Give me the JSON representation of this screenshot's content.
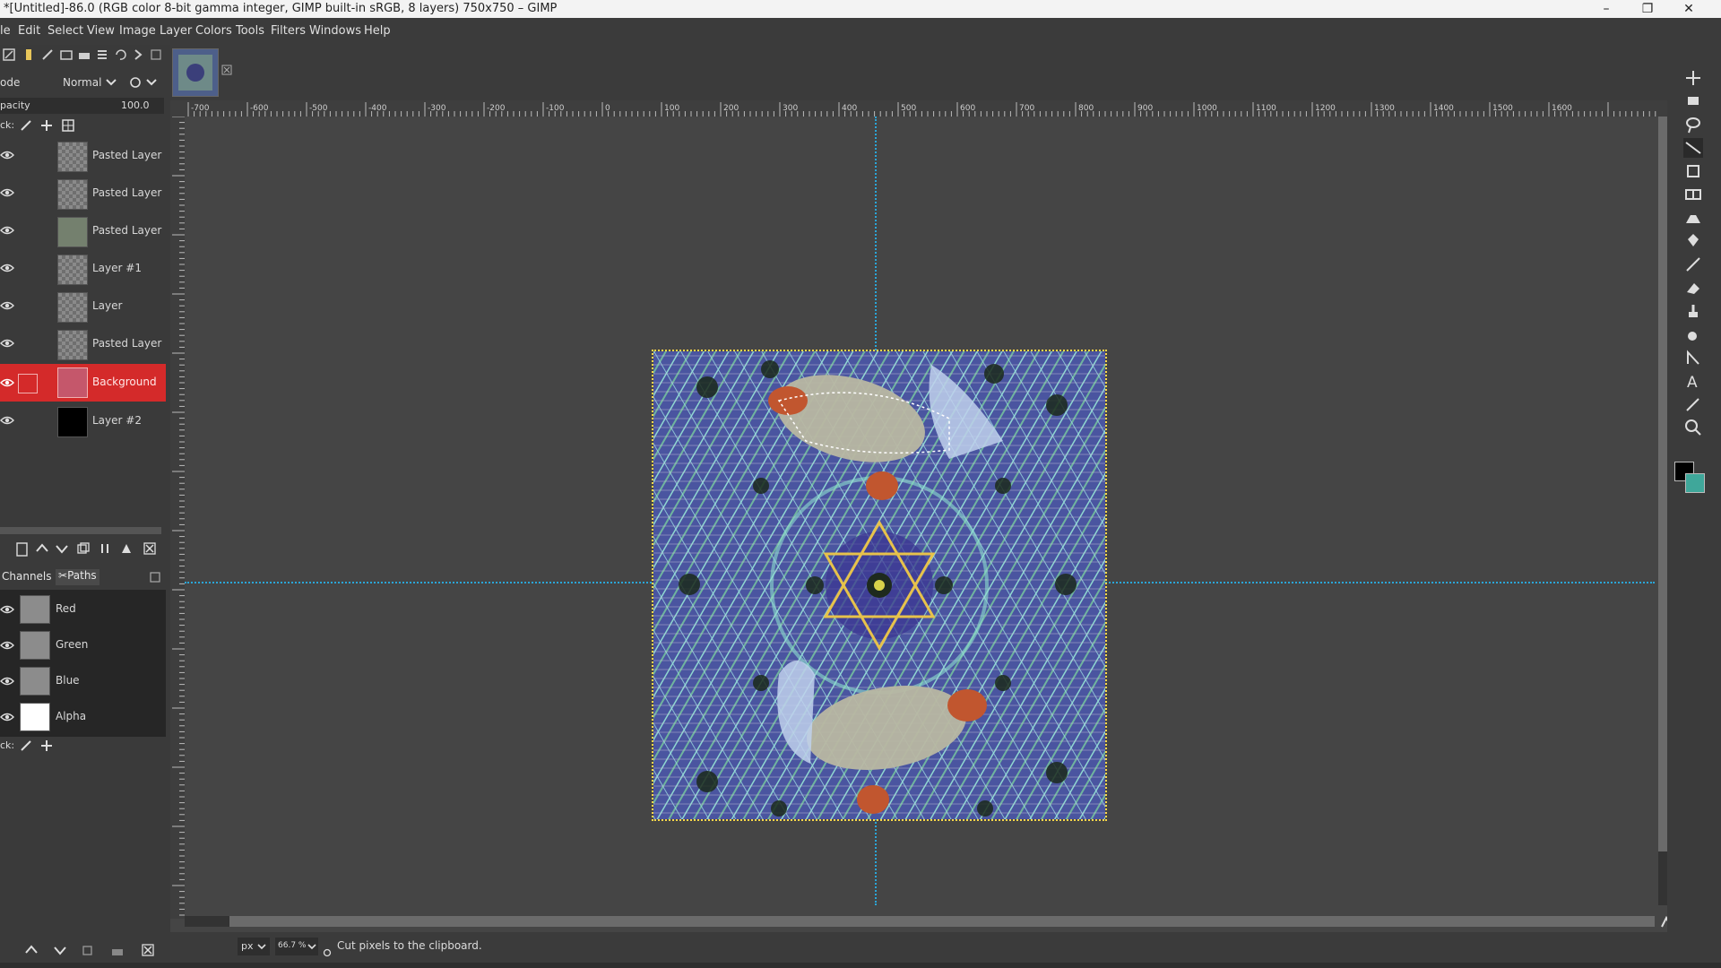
{
  "window": {
    "title": "*[Untitled]-86.0 (RGB color 8-bit gamma integer, GIMP built-in sRGB, 8 layers) 750x750 – GIMP",
    "controls": [
      "–",
      "❐",
      "✕"
    ]
  },
  "menu": [
    "le",
    "Edit",
    "Select",
    "View",
    "Image",
    "Layer",
    "Colors",
    "Tools",
    "Filters",
    "Windows",
    "Help"
  ],
  "layers_panel": {
    "mode_label": "ode",
    "mode_value": "Normal",
    "opacity_label": "pacity",
    "opacity_value": "100.0",
    "lock_label": "ck:",
    "layers": [
      {
        "name": "Pasted Layer",
        "selected": false,
        "thumb": "checker"
      },
      {
        "name": "Pasted Layer",
        "selected": false,
        "thumb": "checker"
      },
      {
        "name": "Pasted Layer",
        "selected": false,
        "thumb": "green"
      },
      {
        "name": "Layer #1",
        "selected": false,
        "thumb": "checker"
      },
      {
        "name": "Layer",
        "selected": false,
        "thumb": "checker"
      },
      {
        "name": "Pasted Layer",
        "selected": false,
        "thumb": "checker"
      },
      {
        "name": "Background",
        "selected": true,
        "thumb": "pink"
      },
      {
        "name": "Layer #2",
        "selected": false,
        "thumb": "black"
      }
    ]
  },
  "channels_panel": {
    "tabs": [
      "Channels",
      "Paths"
    ],
    "channels": [
      {
        "name": "Red",
        "thumb": "gray"
      },
      {
        "name": "Green",
        "thumb": "gray"
      },
      {
        "name": "Blue",
        "thumb": "gray"
      },
      {
        "name": "Alpha",
        "thumb": "white"
      }
    ],
    "lock_label": "ck:"
  },
  "ruler": {
    "labels": [
      "-700",
      "-600",
      "-500",
      "-400",
      "-300",
      "-200",
      "-100",
      "0",
      "100",
      "200",
      "300",
      "400",
      "500",
      "600",
      "700",
      "800",
      "900",
      "1000",
      "1100",
      "1200",
      "1300",
      "1400",
      "1500",
      "1600"
    ]
  },
  "status": {
    "unit": "px",
    "zoom": "66.7 %",
    "message": "Cut pixels to the clipboard."
  },
  "colors": {
    "selected_layer": "#d42a2a",
    "guide": "#2aa6d8",
    "fg_color": "#000000",
    "bg_color": "#3fa79a"
  }
}
